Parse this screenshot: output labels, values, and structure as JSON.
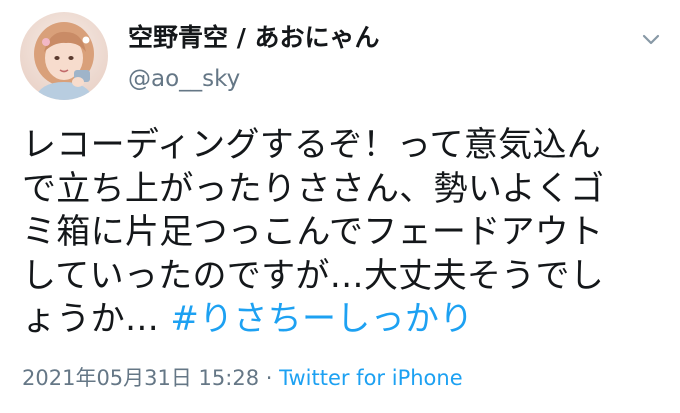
{
  "author": {
    "display_name": "空野青空 / あおにゃん",
    "handle": "@ao__sky",
    "avatar_icon": "profile-photo"
  },
  "menu": {
    "icon": "chevron-down-icon"
  },
  "tweet": {
    "lines": [
      "レコーディングするぞ！って意気込ん",
      "で立ち上がったりささん、勢いよくゴ",
      "ミ箱に片足つっこんでフェードアウト",
      "していったのですが…大丈夫そうでし",
      "ょうか… "
    ],
    "hashtag": "#りさちーしっかり"
  },
  "meta": {
    "timestamp": "2021年05月31日 15:28",
    "separator": " · ",
    "source": "Twitter for iPhone"
  },
  "colors": {
    "text": "#14171a",
    "secondary": "#657786",
    "link": "#1da1f2"
  }
}
